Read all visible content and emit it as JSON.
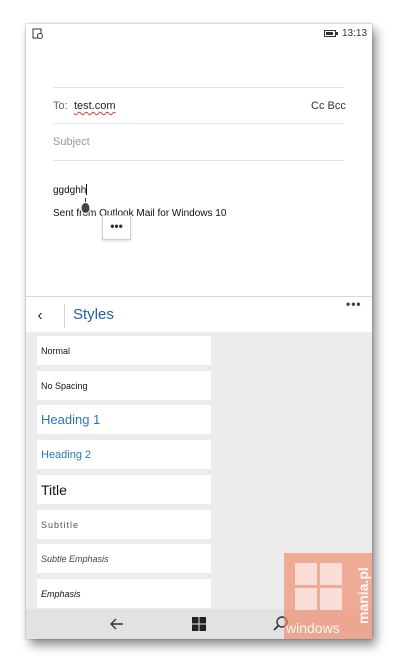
{
  "status_bar": {
    "time": "13:13"
  },
  "compose": {
    "to_label": "To:",
    "to_value": "test.com",
    "cc_bcc": "Cc Bcc",
    "subject_placeholder": "Subject",
    "body_text": "ggdghh",
    "signature": "Sent from Outlook Mail for Windows 10",
    "more_label": "•••"
  },
  "styles_panel": {
    "back_label": "‹",
    "title": "Styles",
    "more_label": "•••",
    "items": [
      {
        "label": "Normal"
      },
      {
        "label": "No Spacing"
      },
      {
        "label": "Heading 1"
      },
      {
        "label": "Heading 2"
      },
      {
        "label": "Title"
      },
      {
        "label": "Subtitle"
      },
      {
        "label": "Subtle Emphasis"
      },
      {
        "label": "Emphasis"
      }
    ]
  },
  "navbar": {
    "icons": [
      "back-arrow-icon",
      "windows-start-icon",
      "search-icon"
    ]
  },
  "watermark": {
    "text": "windows",
    "vertical_text": "mania.pl"
  },
  "colors": {
    "accent": "#1f5fa8",
    "heading": "#2e74b5",
    "panel_bg": "#ececec",
    "navbar_bg": "#e2e2e2",
    "watermark": "#f0825f"
  }
}
